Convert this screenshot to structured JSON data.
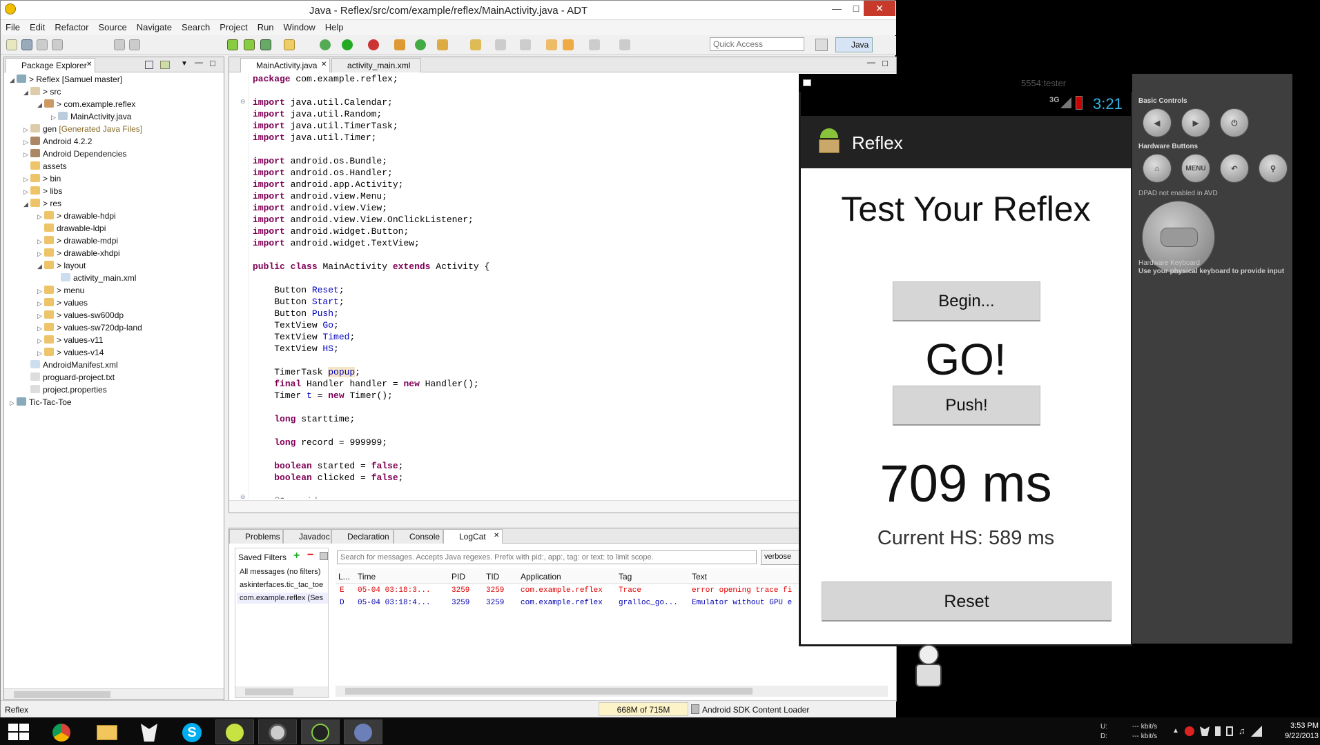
{
  "window": {
    "title": "Java - Reflex/src/com/example/reflex/MainActivity.java - ADT"
  },
  "menu": [
    "File",
    "Edit",
    "Refactor",
    "Source",
    "Navigate",
    "Search",
    "Project",
    "Run",
    "Window",
    "Help"
  ],
  "toolbar": {
    "quick_access_placeholder": "Quick Access",
    "perspective": "Java"
  },
  "package_explorer": {
    "tab": "Package Explorer",
    "items": [
      "> Reflex [Samuel master]",
      "> src",
      "> com.example.reflex",
      "MainActivity.java",
      "gen",
      "[Generated Java Files]",
      "Android 4.2.2",
      "Android Dependencies",
      "assets",
      "> bin",
      "> libs",
      "> res",
      "> drawable-hdpi",
      "drawable-ldpi",
      "> drawable-mdpi",
      "> drawable-xhdpi",
      "> layout",
      "activity_main.xml",
      "> menu",
      "> values",
      "> values-sw600dp",
      "> values-sw720dp-land",
      "> values-v11",
      "> values-v14",
      "AndroidManifest.xml",
      "proguard-project.txt",
      "project.properties",
      "Tic-Tac-Toe"
    ]
  },
  "editor": {
    "tabs": [
      "MainActivity.java",
      "activity_main.xml"
    ],
    "lines": [
      "package com.example.reflex;",
      "",
      "import java.util.Calendar;",
      "import java.util.Random;",
      "import java.util.TimerTask;",
      "import java.util.Timer;",
      "",
      "import android.os.Bundle;",
      "import android.os.Handler;",
      "import android.app.Activity;",
      "import android.view.Menu;",
      "import android.view.View;",
      "import android.view.View.OnClickListener;",
      "import android.widget.Button;",
      "import android.widget.TextView;",
      "",
      "public class MainActivity extends Activity {",
      "",
      "    Button Reset;",
      "    Button Start;",
      "    Button Push;",
      "    TextView Go;",
      "    TextView Timed;",
      "    TextView HS;",
      "",
      "    TimerTask popup;",
      "    final Handler handler = new Handler();",
      "    Timer t = new Timer();",
      "",
      "    long starttime;",
      "",
      "    long record = 999999;",
      "",
      "    boolean started = false;",
      "    boolean clicked = false;",
      "",
      "    @Override"
    ]
  },
  "bottom_panel": {
    "tabs": [
      "Problems",
      "Javadoc",
      "Declaration",
      "Console",
      "LogCat"
    ],
    "saved_filters_label": "Saved Filters",
    "filters": [
      "All messages (no filters)",
      "askinterfaces.tic_tac_toe",
      "com.example.reflex (Ses"
    ],
    "search_placeholder": "Search for messages. Accepts Java regexes. Prefix with pid:, app:, tag: or text: to limit scope.",
    "level": "verbose",
    "columns": [
      "L...",
      "Time",
      "PID",
      "TID",
      "Application",
      "Tag",
      "Text"
    ],
    "rows": [
      {
        "level": "E",
        "time": "05-04 03:18:3...",
        "pid": "3259",
        "tid": "3259",
        "app": "com.example.reflex",
        "tag": "Trace",
        "text": "error opening trace fi"
      },
      {
        "level": "D",
        "time": "05-04 03:18:4...",
        "pid": "3259",
        "tid": "3259",
        "app": "com.example.reflex",
        "tag": "gralloc_go...",
        "text": "Emulator without GPU e"
      }
    ]
  },
  "status": {
    "left": "Reflex",
    "memory": "668M of 715M",
    "loader": "Android SDK Content Loader"
  },
  "emulator": {
    "title": "5554:tester",
    "network": "3G",
    "clock": "3:21",
    "app_title": "Reflex",
    "heading": "Test Your Reflex",
    "begin_button": "Begin...",
    "go_text": "GO!",
    "push_button": "Push!",
    "time_text": "709 ms",
    "hs_text": "Current HS: 589 ms",
    "reset_button": "Reset"
  },
  "emulator_controls": {
    "basic_controls": "Basic Controls",
    "hardware_buttons": "Hardware Buttons",
    "menu_label": "MENU",
    "dpad_label": "DPAD not enabled in AVD",
    "keyboard_label": "Hardware Keyboard",
    "keyboard_hint": "Use your physical keyboard to provide input"
  },
  "taskbar": {
    "net_u_label": "U:",
    "net_d_label": "D:",
    "net_u": "--- kbit/s",
    "net_d": "--- kbit/s",
    "time": "3:53 PM",
    "date": "9/22/2013"
  },
  "colors": {
    "keyword": "#7f0055",
    "field": "#0000c0",
    "error": "#e00000",
    "debug": "#0000b0",
    "accent": "#33b5e5"
  }
}
